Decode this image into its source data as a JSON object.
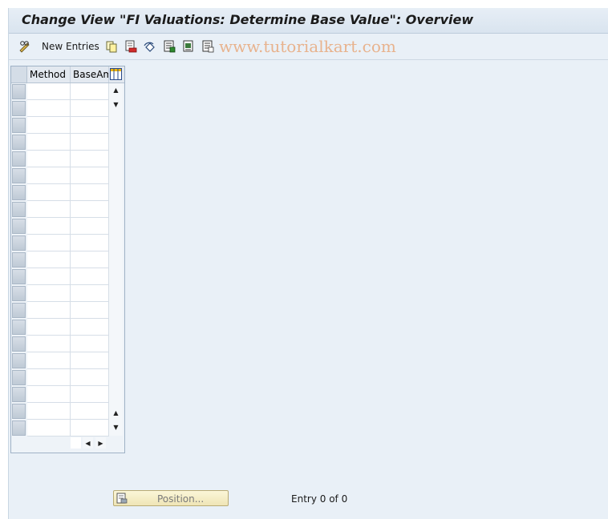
{
  "window": {
    "title": "Change View \"FI Valuations: Determine Base Value\": Overview"
  },
  "toolbar": {
    "new_entries_label": "New Entries",
    "icons": [
      "change-display-icon",
      "copy-icon",
      "delete-icon",
      "undo-icon",
      "select-all-icon",
      "select-block-icon",
      "deselect-all-icon"
    ]
  },
  "watermark": "www.tutorialkart.com",
  "table": {
    "columns": [
      "Method",
      "BaseAmt"
    ],
    "row_count": 21
  },
  "footer": {
    "position_button_label": "Position...",
    "entry_status": "Entry 0 of 0"
  },
  "colors": {
    "background": "#e9f0f7",
    "title_bar": "#dce6f0",
    "position_button": "#f5edc6",
    "watermark": "#e8b38e"
  }
}
